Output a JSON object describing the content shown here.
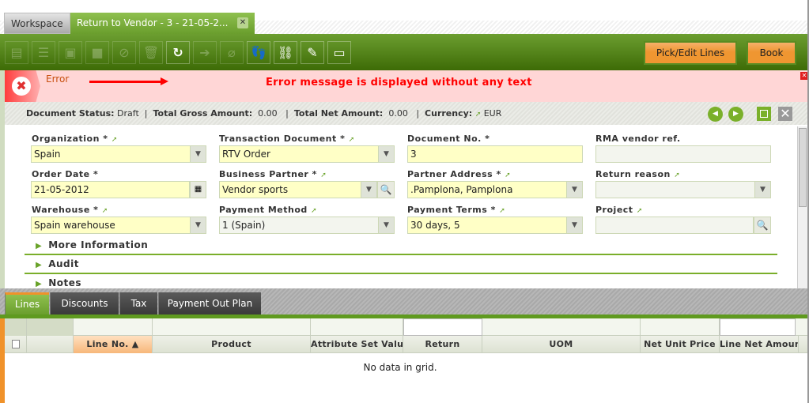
{
  "window_tabs": [
    {
      "label": "Workspace"
    },
    {
      "label": "Return to Vendor - 3 - 21-05-2..."
    }
  ],
  "toolbar": {
    "buttons": [
      "new-document",
      "new-row",
      "save",
      "save-close",
      "undo",
      "delete",
      "refresh",
      "export",
      "attach",
      "audit-trail",
      "link",
      "customize",
      "toggle-form"
    ],
    "pick_edit": "Pick/Edit Lines",
    "book": "Book"
  },
  "error": {
    "title": "Error",
    "message": "Error message is displayed without any text",
    "color": "#ff0000"
  },
  "status": {
    "doc_status_label": "Document Status:",
    "doc_status": "Draft",
    "gross_label": "Total Gross Amount:",
    "gross": "0.00",
    "net_label": "Total Net Amount:",
    "net": "0.00",
    "currency_label": "Currency:",
    "currency": "EUR"
  },
  "form": {
    "organization": {
      "label": "Organization *",
      "value": "Spain"
    },
    "transaction_document": {
      "label": "Transaction Document *",
      "value": "RTV Order"
    },
    "document_no": {
      "label": "Document No. *",
      "value": "3"
    },
    "rma_vendor_ref": {
      "label": "RMA vendor ref.",
      "value": ""
    },
    "order_date": {
      "label": "Order Date *",
      "value": "21-05-2012"
    },
    "business_partner": {
      "label": "Business Partner *",
      "value": "Vendor sports"
    },
    "partner_address": {
      "label": "Partner Address *",
      "value": ".Pamplona, Pamplona"
    },
    "return_reason": {
      "label": "Return reason",
      "value": ""
    },
    "warehouse": {
      "label": "Warehouse *",
      "value": "Spain warehouse"
    },
    "payment_method": {
      "label": "Payment Method",
      "value": "1 (Spain)"
    },
    "payment_terms": {
      "label": "Payment Terms *",
      "value": "30 days, 5"
    },
    "project": {
      "label": "Project",
      "value": ""
    }
  },
  "sections": [
    "More Information",
    "Audit",
    "Notes"
  ],
  "sub_tabs": [
    "Lines",
    "Discounts",
    "Tax",
    "Payment Out Plan"
  ],
  "grid": {
    "columns": [
      "Line No. ▲",
      "Product",
      "Attribute Set Value",
      "Return",
      "UOM",
      "Net Unit Price",
      "Line Net Amount"
    ],
    "empty": "No data in grid."
  }
}
